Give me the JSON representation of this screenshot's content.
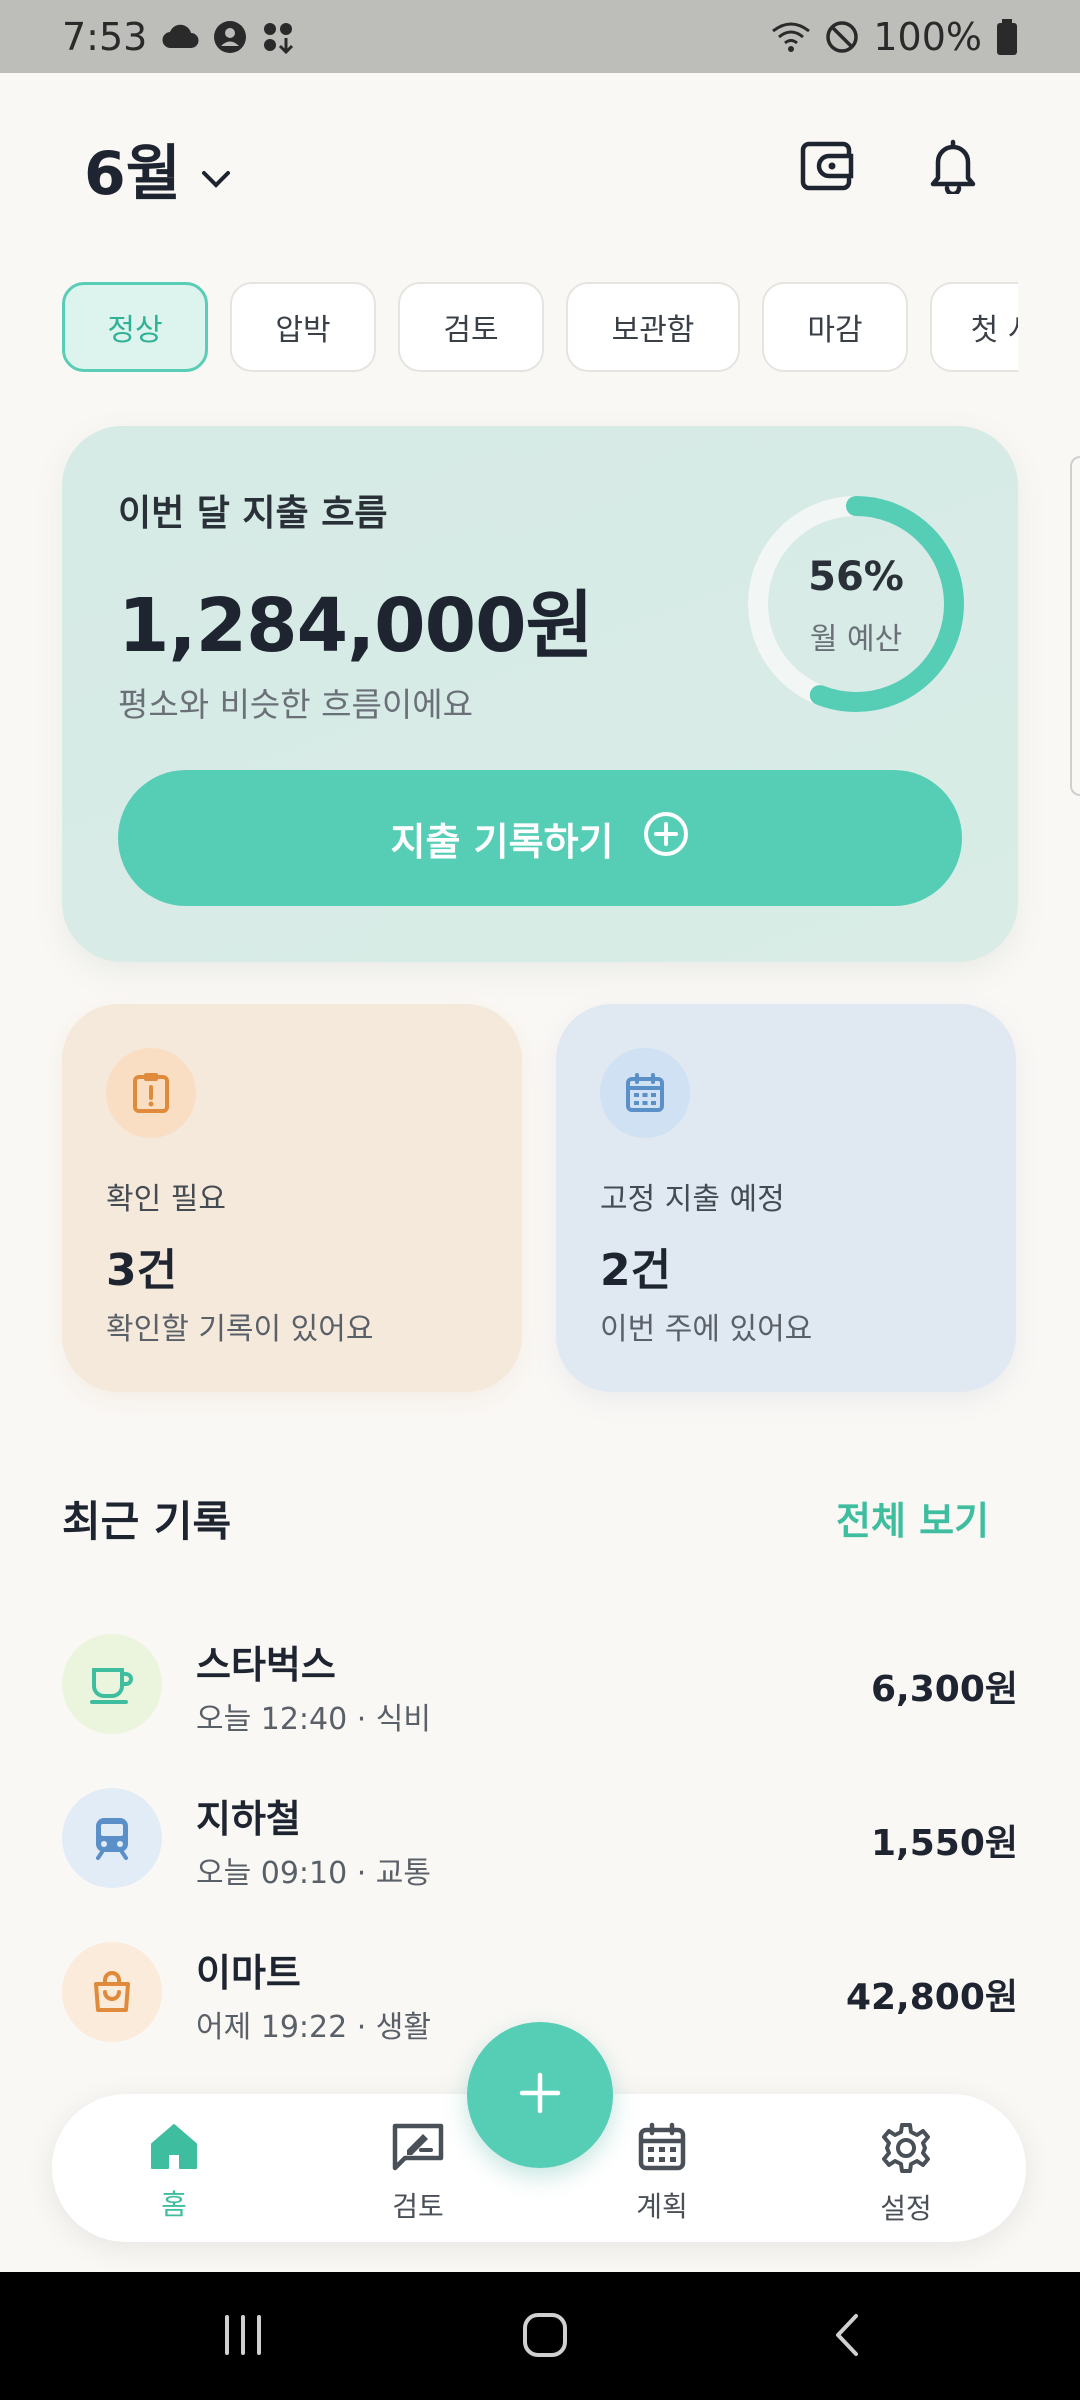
{
  "status_bar": {
    "time": "7:53",
    "battery": "100%"
  },
  "header": {
    "month": "6월"
  },
  "chips": [
    "정상",
    "압박",
    "검토",
    "보관함",
    "마감",
    "첫 시"
  ],
  "summary_card": {
    "title": "이번 달 지출 흐름",
    "amount": "1,284,000원",
    "subtitle": "평소와 비슷한 흐름이에요",
    "budget_percent_label": "56%",
    "budget_percent": 56,
    "budget_label": "월 예산",
    "record_button": "지출 기록하기"
  },
  "info_cards": [
    {
      "title": "확인 필요",
      "count": "3건",
      "desc": "확인할 기록이 있어요",
      "icon": "alert-clipboard-icon"
    },
    {
      "title": "고정 지출 예정",
      "count": "2건",
      "desc": "이번 주에 있어요",
      "icon": "calendar-icon"
    }
  ],
  "recent": {
    "title": "최근 기록",
    "see_all": "전체 보기",
    "items": [
      {
        "name": "스타벅스",
        "meta": "오늘 12:40 · 식비",
        "amount": "6,300원",
        "icon": "coffee-cup-icon"
      },
      {
        "name": "지하철",
        "meta": "오늘 09:10 · 교통",
        "amount": "1,550원",
        "icon": "train-icon"
      },
      {
        "name": "이마트",
        "meta": "어제 19:22 · 생활",
        "amount": "42,800원",
        "icon": "shopping-bag-icon"
      }
    ]
  },
  "bottom_nav": [
    {
      "label": "홈",
      "icon": "home-icon"
    },
    {
      "label": "검토",
      "icon": "review-icon"
    },
    {
      "label": "계획",
      "icon": "calendar-icon"
    },
    {
      "label": "설정",
      "icon": "gear-icon"
    }
  ],
  "colors": {
    "accent": "#56CDB5",
    "accent_text": "#3FBE9F",
    "orange": "#E08A3C",
    "blue": "#5A8FC8"
  }
}
